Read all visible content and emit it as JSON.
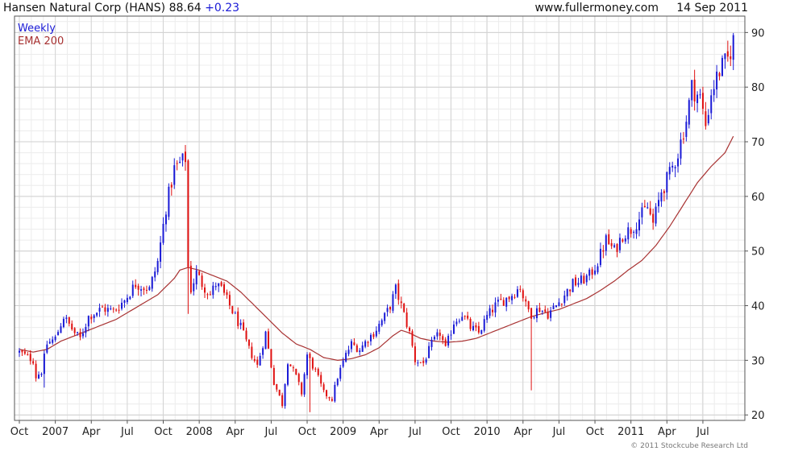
{
  "header": {
    "title": "Hansen Natural Corp (HANS)",
    "price": "88.64",
    "change": "+0.23",
    "website": "www.fullermoney.com",
    "date": "14 Sep 2011"
  },
  "legend": {
    "weekly": "Weekly",
    "ema": "EMA 200"
  },
  "footer": {
    "copyright": "© 2011 Stockcube Research Ltd"
  },
  "colors": {
    "up": "#1a1ad6",
    "down": "#e01010",
    "ema": "#a83232",
    "grid": "#dcdcdc",
    "axis": "#555555"
  },
  "chart_data": {
    "type": "candlestick",
    "frequency": "weekly",
    "ylim": [
      19,
      93
    ],
    "yticks": [
      20,
      30,
      40,
      50,
      60,
      70,
      80,
      90
    ],
    "xlim": [
      0,
      261
    ],
    "xticks": [
      {
        "label": "Oct",
        "x": 0
      },
      {
        "label": "2007",
        "x": 13
      },
      {
        "label": "Apr",
        "x": 26
      },
      {
        "label": "Jul",
        "x": 39
      },
      {
        "label": "Oct",
        "x": 52
      },
      {
        "label": "2008",
        "x": 65
      },
      {
        "label": "Apr",
        "x": 78
      },
      {
        "label": "Jul",
        "x": 91
      },
      {
        "label": "Oct",
        "x": 104
      },
      {
        "label": "2009",
        "x": 117
      },
      {
        "label": "Apr",
        "x": 130
      },
      {
        "label": "Jul",
        "x": 143
      },
      {
        "label": "Oct",
        "x": 156
      },
      {
        "label": "2010",
        "x": 169
      },
      {
        "label": "Apr",
        "x": 182
      },
      {
        "label": "Jul",
        "x": 195
      },
      {
        "label": "Oct",
        "x": 208
      },
      {
        "label": "2011",
        "x": 221
      },
      {
        "label": "Apr",
        "x": 234
      },
      {
        "label": "Jul",
        "x": 247
      }
    ],
    "close_anchors": [
      [
        0,
        31.5
      ],
      [
        5,
        30
      ],
      [
        6,
        27
      ],
      [
        8,
        28
      ],
      [
        10,
        33
      ],
      [
        13,
        34
      ],
      [
        16,
        38
      ],
      [
        20,
        35
      ],
      [
        22,
        34
      ],
      [
        25,
        38
      ],
      [
        30,
        39.5
      ],
      [
        34,
        39
      ],
      [
        38,
        41
      ],
      [
        42,
        44
      ],
      [
        47,
        43
      ],
      [
        50,
        48
      ],
      [
        53,
        58
      ],
      [
        56,
        65
      ],
      [
        58,
        66
      ],
      [
        60,
        67
      ],
      [
        61,
        47
      ],
      [
        62,
        43
      ],
      [
        64,
        46
      ],
      [
        66,
        44
      ],
      [
        69,
        42
      ],
      [
        71,
        44
      ],
      [
        73,
        43
      ],
      [
        76,
        40
      ],
      [
        80,
        36
      ],
      [
        83,
        32
      ],
      [
        86,
        29
      ],
      [
        89,
        35
      ],
      [
        92,
        26
      ],
      [
        95,
        22
      ],
      [
        97,
        30
      ],
      [
        100,
        27
      ],
      [
        102,
        24
      ],
      [
        104,
        31
      ],
      [
        107,
        28
      ],
      [
        110,
        24
      ],
      [
        113,
        23
      ],
      [
        115,
        27
      ],
      [
        118,
        31
      ],
      [
        120,
        33
      ],
      [
        123,
        32
      ],
      [
        126,
        34
      ],
      [
        128,
        35
      ],
      [
        132,
        38
      ],
      [
        134,
        40
      ],
      [
        136,
        43
      ],
      [
        138,
        40
      ],
      [
        141,
        35
      ],
      [
        143,
        30
      ],
      [
        146,
        29.5
      ],
      [
        149,
        33
      ],
      [
        152,
        35
      ],
      [
        154,
        32
      ],
      [
        157,
        37
      ],
      [
        160,
        38.5
      ],
      [
        163,
        36
      ],
      [
        166,
        35
      ],
      [
        169,
        38
      ],
      [
        172,
        40
      ],
      [
        175,
        41
      ],
      [
        178,
        42
      ],
      [
        181,
        43.5
      ],
      [
        183,
        40
      ],
      [
        185,
        38.5
      ],
      [
        188,
        39.5
      ],
      [
        191,
        38.5
      ],
      [
        194,
        40
      ],
      [
        197,
        42
      ],
      [
        200,
        44
      ],
      [
        203,
        44.5
      ],
      [
        206,
        45.5
      ],
      [
        209,
        48
      ],
      [
        212,
        52
      ],
      [
        215,
        50
      ],
      [
        218,
        53
      ],
      [
        221,
        54
      ],
      [
        224,
        56
      ],
      [
        227,
        58
      ],
      [
        229,
        55
      ],
      [
        232,
        61
      ],
      [
        235,
        64
      ],
      [
        238,
        68
      ],
      [
        241,
        74
      ],
      [
        243,
        80
      ],
      [
        246,
        78
      ],
      [
        248,
        73
      ],
      [
        250,
        79
      ],
      [
        253,
        83
      ],
      [
        256,
        85
      ],
      [
        258,
        88.6
      ]
    ],
    "spikes": [
      {
        "x": 61,
        "low": 38.5
      },
      {
        "x": 185,
        "low": 24.5
      },
      {
        "x": 105,
        "low": 20.5
      },
      {
        "x": 9,
        "low": 25
      }
    ],
    "ema_anchors": [
      [
        0,
        32
      ],
      [
        5,
        31.5
      ],
      [
        10,
        32
      ],
      [
        15,
        33.5
      ],
      [
        20,
        34.5
      ],
      [
        25,
        35.5
      ],
      [
        30,
        36.5
      ],
      [
        35,
        37.5
      ],
      [
        40,
        39
      ],
      [
        45,
        40.5
      ],
      [
        50,
        42
      ],
      [
        53,
        43.5
      ],
      [
        56,
        45
      ],
      [
        58,
        46.5
      ],
      [
        61,
        47
      ],
      [
        65,
        46.5
      ],
      [
        70,
        45.5
      ],
      [
        75,
        44.5
      ],
      [
        80,
        42.5
      ],
      [
        85,
        40
      ],
      [
        90,
        37.5
      ],
      [
        95,
        35
      ],
      [
        100,
        33
      ],
      [
        105,
        32
      ],
      [
        110,
        30.5
      ],
      [
        115,
        30
      ],
      [
        120,
        30.3
      ],
      [
        125,
        31
      ],
      [
        130,
        32.3
      ],
      [
        135,
        34.5
      ],
      [
        138,
        35.5
      ],
      [
        141,
        35
      ],
      [
        145,
        34
      ],
      [
        150,
        33.5
      ],
      [
        155,
        33.3
      ],
      [
        160,
        33.5
      ],
      [
        165,
        34
      ],
      [
        170,
        35
      ],
      [
        175,
        36
      ],
      [
        180,
        37
      ],
      [
        185,
        38
      ],
      [
        190,
        38.7
      ],
      [
        195,
        39.3
      ],
      [
        200,
        40.3
      ],
      [
        205,
        41.3
      ],
      [
        210,
        42.8
      ],
      [
        215,
        44.5
      ],
      [
        220,
        46.5
      ],
      [
        225,
        48.3
      ],
      [
        230,
        51
      ],
      [
        235,
        54.5
      ],
      [
        240,
        58.5
      ],
      [
        245,
        62.5
      ],
      [
        250,
        65.5
      ],
      [
        255,
        68
      ],
      [
        258,
        71
      ]
    ]
  }
}
